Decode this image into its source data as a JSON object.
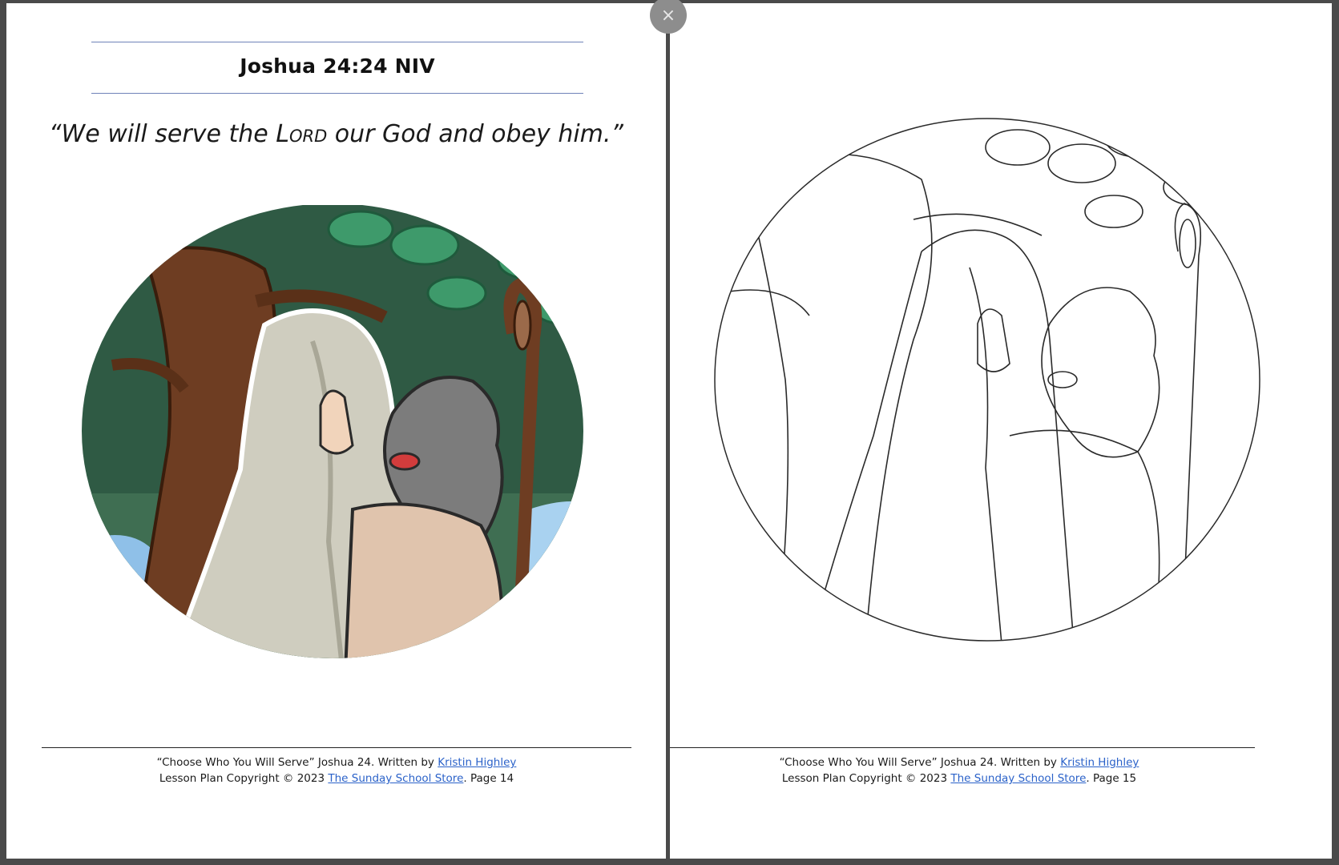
{
  "viewer": {
    "close_symbol": "×"
  },
  "left_page": {
    "verse_reference": "Joshua 24:24  NIV",
    "quote_open": "“We will serve the ",
    "quote_lord": "Lord",
    "quote_close": " our God and obey him.”",
    "footer": {
      "line1_text": "“Choose Who You Will Serve” Joshua 24.  Written by ",
      "author_link": "Kristin Highley",
      "line2_text": "Lesson Plan Copyright © 2023 ",
      "store_link": "The Sunday School Store",
      "page_label": ". Page 14"
    }
  },
  "right_page": {
    "footer": {
      "line1_text": "“Choose Who You Will Serve” Joshua 24.  Written by ",
      "author_link": "Kristin Highley",
      "line2_text": "Lesson Plan Copyright © 2023 ",
      "store_link": "The Sunday School Store",
      "page_label": ". Page 15"
    }
  },
  "colors": {
    "link": "#2b62c9",
    "title_rule": "#6f82b8",
    "viewer_bg": "#4a4a4a"
  }
}
